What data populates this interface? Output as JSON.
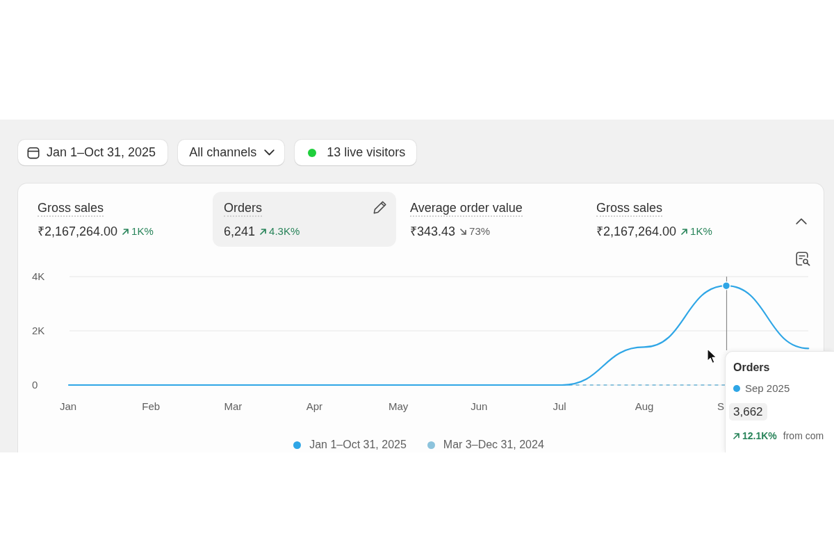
{
  "filters": [
    {
      "kind": "date",
      "label": "Jan 1–Oct 31, 2025"
    },
    {
      "kind": "dropdown",
      "label": "All channels"
    },
    {
      "kind": "live",
      "label": "13 live visitors"
    }
  ],
  "metrics_card": {
    "expanded": true,
    "metrics": [
      {
        "label": "Gross sales",
        "value": "₹2,167,264.00",
        "trend": {
          "kind": "up",
          "value": "1K%"
        },
        "selected": false
      },
      {
        "label": "Orders",
        "value": "6,241",
        "trend": {
          "kind": "up",
          "value": "4.3K%"
        },
        "selected": true
      },
      {
        "label": "Average order value",
        "value": "₹343.43",
        "trend": {
          "kind": "down",
          "value": "73%"
        },
        "selected": false
      },
      {
        "label": "Gross sales",
        "value": "₹2,167,264.00",
        "trend": {
          "kind": "up",
          "value": "1K%"
        },
        "selected": false
      }
    ],
    "chart": {
      "chart_data": {
        "type": "line",
        "categories": [
          "Jan",
          "Feb",
          "Mar",
          "Apr",
          "May",
          "Jun",
          "Jul",
          "Aug",
          "S",
          null
        ],
        "series": [
          {
            "name": "Jan 1–Oct 31, 2025",
            "color": "#2fa6e6",
            "line_style": "solid",
            "values": [
              0,
              0,
              0,
              0,
              0,
              0,
              0,
              1400,
              3662,
              1350
            ]
          },
          {
            "name": "Mar 3–Dec 31, 2024",
            "color": "#8cc3dc",
            "line_style": "dashed",
            "values": [
              null,
              null,
              null,
              null,
              null,
              null,
              0,
              0,
              0,
              null
            ]
          }
        ],
        "ylim": [
          0,
          4000
        ],
        "yticks": [
          0,
          {
            "value": 2000,
            "label": "2K"
          },
          {
            "value": 4000,
            "label": "4K"
          }
        ],
        "legend": "bottom",
        "annotations": [
          {
            "x": "S"
          }
        ]
      },
      "tooltip": {
        "title": "Orders",
        "period": "Sep 2025",
        "value": "3,662",
        "trend": {
          "kind": "up",
          "value": "12.1K%"
        },
        "note": "from com"
      }
    }
  }
}
